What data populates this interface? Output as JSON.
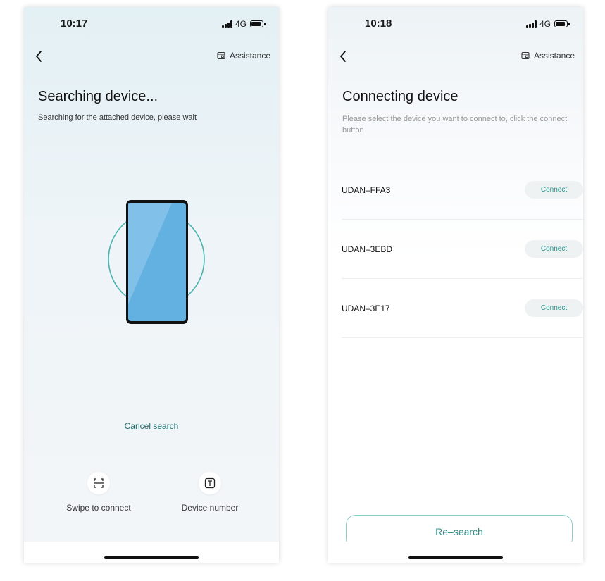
{
  "colors": {
    "accent": "#2f9088",
    "phone_screen": "#62b1e0",
    "ring": "#4ab3ad"
  },
  "left_screen": {
    "status": {
      "time": "10:17",
      "network": "4G"
    },
    "nav": {
      "back_icon": "chevron-left-icon",
      "assistance_label": "Assistance",
      "assistance_icon": "help-card-icon"
    },
    "title": "Searching device...",
    "subtitle": "Searching for the attached device, please wait",
    "cancel_label": "Cancel search",
    "options": [
      {
        "icon": "scan-icon",
        "label": "Swipe to connect"
      },
      {
        "icon": "text-box-icon",
        "label": "Device number"
      }
    ]
  },
  "right_screen": {
    "status": {
      "time": "10:18",
      "network": "4G"
    },
    "nav": {
      "back_icon": "chevron-left-icon",
      "assistance_label": "Assistance",
      "assistance_icon": "help-card-icon"
    },
    "title": "Connecting device",
    "subtitle": "Please select the device you want to connect to, click the connect button",
    "devices": [
      {
        "name": "UDAN–FFA3",
        "action": "Connect"
      },
      {
        "name": "UDAN–3EBD",
        "action": "Connect"
      },
      {
        "name": "UDAN–3E17",
        "action": "Connect"
      }
    ],
    "research_label": "Re–search"
  }
}
